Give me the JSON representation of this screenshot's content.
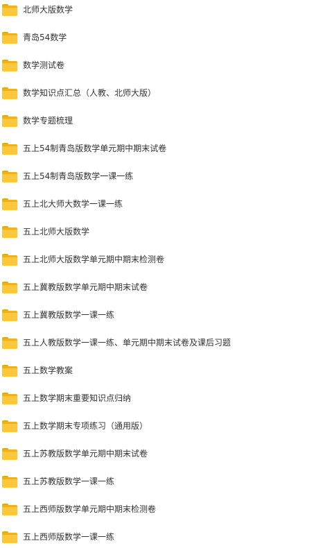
{
  "folders": {
    "icon": "folder-icon",
    "icon_color": "#fcc73b",
    "items": [
      {
        "name": "北师大版数学"
      },
      {
        "name": "青岛54数学"
      },
      {
        "name": "数学测试卷"
      },
      {
        "name": "数学知识点汇总（人教、北师大版）"
      },
      {
        "name": "数学专题梳理"
      },
      {
        "name": "五上54制青岛版数学单元期中期末试卷"
      },
      {
        "name": "五上54制青岛版数学一课一练"
      },
      {
        "name": "五上北大师大数学一课一练"
      },
      {
        "name": "五上北师大版数学"
      },
      {
        "name": "五上北师大版数学单元期中期末检测卷"
      },
      {
        "name": "五上冀教版数学单元期中期末试卷"
      },
      {
        "name": "五上冀教版数学一课一练"
      },
      {
        "name": "五上人教版数学一课一练、单元期中期末试卷及课后习题"
      },
      {
        "name": "五上数学教案"
      },
      {
        "name": "五上数学期末重要知识点归纳"
      },
      {
        "name": "五上数学期末专项练习（通用版）"
      },
      {
        "name": "五上苏教版数学单元期中期末试卷"
      },
      {
        "name": "五上苏教版数学一课一练"
      },
      {
        "name": "五上西师版数学单元期中期末检测卷"
      },
      {
        "name": "五上西师版数学一课一练"
      }
    ]
  }
}
